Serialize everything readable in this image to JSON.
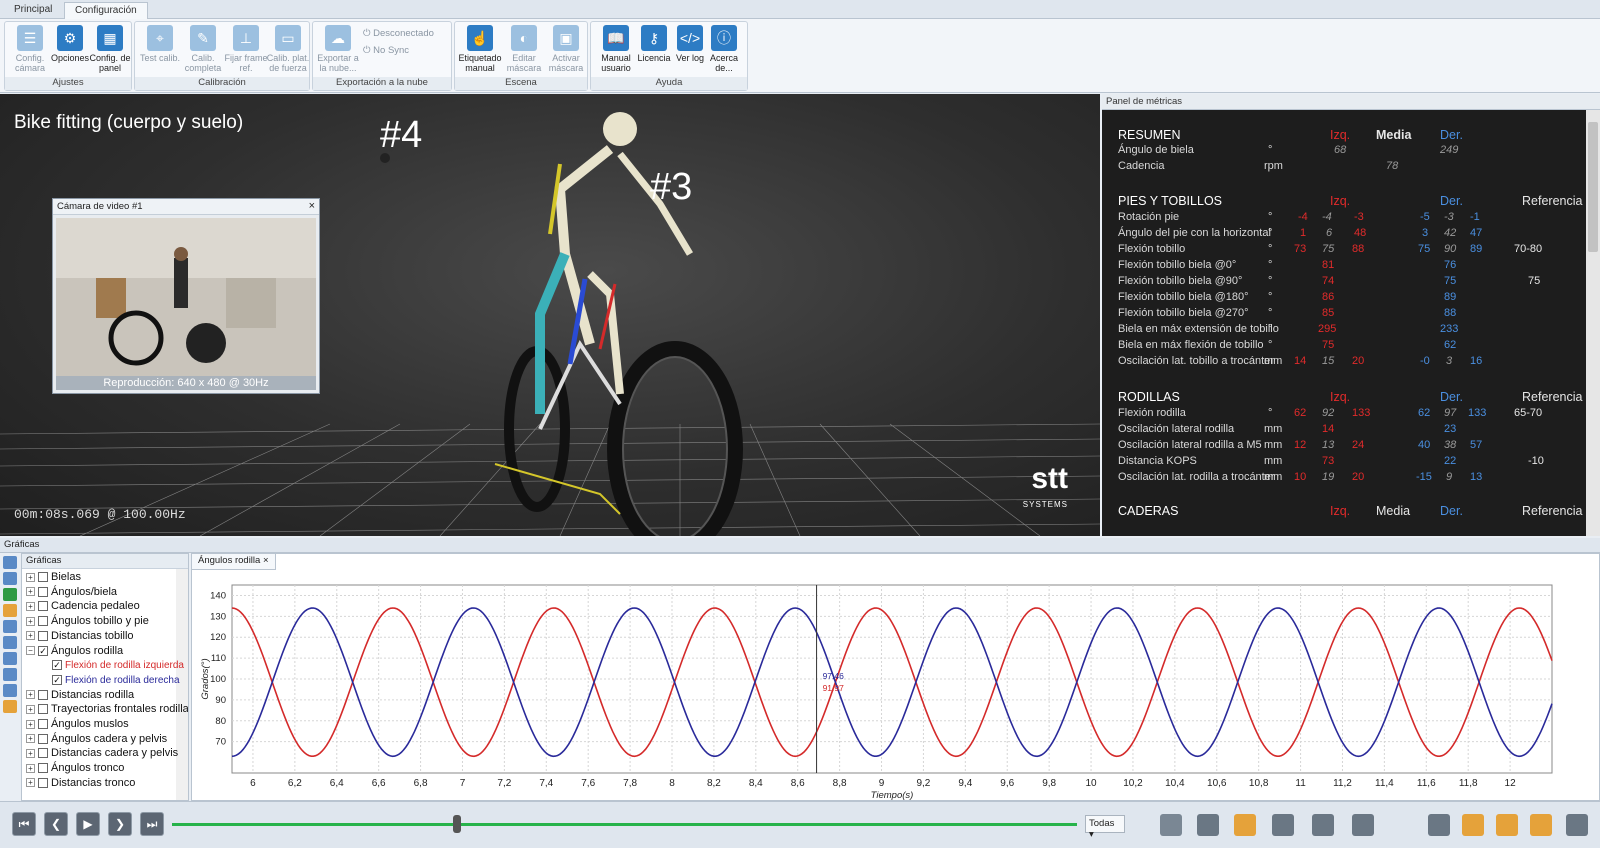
{
  "tabs": [
    {
      "label": "Principal"
    },
    {
      "label": "Configuración"
    }
  ],
  "ribbon": {
    "groups": {
      "ajustes": "Ajustes",
      "calibracion": "Calibración",
      "exportacion": "Exportación a la nube",
      "escena": "Escena",
      "ayuda": "Ayuda"
    },
    "buttons": {
      "config_camara": "Config. cámara",
      "opciones": "Opciones",
      "config_panel": "Config. de panel",
      "test_calib": "Test calib.",
      "calib_completa": "Calib. completa",
      "fijar_frame": "Fijar frame ref.",
      "calib_plat": "Calib. plat. de fuerza",
      "exportar": "Exportar a la nube...",
      "desconectado": "Desconectado",
      "no_sync": "No Sync",
      "etiquetado": "Etiquetado manual",
      "editar_mascara": "Editar máscara",
      "activar_mascara": "Activar máscara",
      "manual_usuario": "Manual usuario",
      "licencia": "Licencia",
      "ver_log": "Ver log",
      "acerca": "Acerca de..."
    }
  },
  "view3d": {
    "title": "Bike fitting (cuerpo y suelo)",
    "marker4": "#4",
    "marker3": "#3",
    "timestamp": "00m:08s.069 @ 100.00Hz",
    "logo": "stt",
    "logo_sub": "SYSTEMS"
  },
  "video": {
    "title": "Cámara de video #1",
    "close": "×",
    "caption": "Reproducción: 640 x 480 @ 30Hz"
  },
  "metrics": {
    "panel_title": "Panel de métricas",
    "col_izq": "Izq.",
    "col_media": "Media",
    "col_der": "Der.",
    "col_ref": "Referencia",
    "sections": {
      "resumen": "RESUMEN",
      "pies": "PIES Y TOBILLOS",
      "rodillas": "RODILLAS",
      "caderas": "CADERAS"
    },
    "rows": {
      "angulo_biela": {
        "label": "Ángulo de biela",
        "unit": "°",
        "izq": "68",
        "der": "249"
      },
      "cadencia": {
        "label": "Cadencia",
        "unit": "rpm",
        "media": "78"
      },
      "rotacion_pie": {
        "label": "Rotación pie",
        "unit": "°",
        "i1": "-4",
        "i2": "-4",
        "i3": "-3",
        "d1": "-5",
        "d2": "-3",
        "d3": "-1"
      },
      "angulo_pie": {
        "label": "Ángulo del pie con la horizontal",
        "unit": "°",
        "i1": "1",
        "i2": "6",
        "i3": "48",
        "d1": "3",
        "d2": "42",
        "d3": "47"
      },
      "flexion_tobillo": {
        "label": "Flexión tobillo",
        "unit": "°",
        "i1": "73",
        "i2": "75",
        "i3": "88",
        "d1": "75",
        "d2": "90",
        "d3": "89",
        "ref": "70-80"
      },
      "flex_0": {
        "label": "Flexión tobillo biela @0°",
        "unit": "°",
        "i": "81",
        "d": "76"
      },
      "flex_90": {
        "label": "Flexión tobillo biela @90°",
        "unit": "°",
        "i": "74",
        "d": "75",
        "ref": "75"
      },
      "flex_180": {
        "label": "Flexión tobillo biela @180°",
        "unit": "°",
        "i": "86",
        "d": "89"
      },
      "flex_270": {
        "label": "Flexión tobillo biela @270°",
        "unit": "°",
        "i": "85",
        "d": "88"
      },
      "biela_max_ext": {
        "label": "Biela en máx extensión de tobillo",
        "unit": "°",
        "i": "295",
        "d": "233"
      },
      "biela_max_flex": {
        "label": "Biela en máx flexión de tobillo",
        "unit": "°",
        "i": "75",
        "d": "62"
      },
      "osc_tobillo": {
        "label": "Oscilación lat. tobillo a trocánter",
        "unit": "mm",
        "i1": "14",
        "i2": "15",
        "i3": "20",
        "d1": "-0",
        "d2": "3",
        "d3": "16"
      },
      "flexion_rodilla": {
        "label": "Flexión rodilla",
        "unit": "°",
        "i1": "62",
        "i2": "92",
        "i3": "133",
        "d1": "62",
        "d2": "97",
        "d3": "133",
        "ref": "65-70"
      },
      "osc_rodilla": {
        "label": "Oscilación lateral rodilla",
        "unit": "mm",
        "i": "14",
        "d": "23"
      },
      "osc_rodilla_m5": {
        "label": "Oscilación lateral rodilla a M5",
        "unit": "mm",
        "i1": "12",
        "i2": "13",
        "i3": "24",
        "d1": "40",
        "d2": "38",
        "d3": "57"
      },
      "kops": {
        "label": "Distancia KOPS",
        "unit": "mm",
        "i": "73",
        "d": "22",
        "ref": "-10"
      },
      "osc_rod_troc": {
        "label": "Oscilación lat. rodilla a trocánter",
        "unit": "mm",
        "i1": "10",
        "i2": "19",
        "i3": "20",
        "d1": "-15",
        "d2": "9",
        "d3": "13"
      }
    }
  },
  "graphs": {
    "header": "Gráficas",
    "tree_title": "Gráficas",
    "tree": [
      {
        "label": "Bielas"
      },
      {
        "label": "Ángulos/biela"
      },
      {
        "label": "Cadencia pedaleo"
      },
      {
        "label": "Ángulos tobillo y pie"
      },
      {
        "label": "Distancias tobillo"
      },
      {
        "label": "Ángulos rodilla"
      },
      {
        "label": "Flexión de rodilla izquierda"
      },
      {
        "label": "Flexión de rodilla derecha"
      },
      {
        "label": "Distancias rodilla"
      },
      {
        "label": "Trayectorias frontales rodilla"
      },
      {
        "label": "Ángulos muslos"
      },
      {
        "label": "Ángulos cadera y pelvis"
      },
      {
        "label": "Distancias cadera y pelvis"
      },
      {
        "label": "Ángulos tronco"
      },
      {
        "label": "Distancias tronco"
      }
    ],
    "chart_tab": "Ángulos rodilla",
    "chart_tab_close": "×",
    "speed": "Todas"
  },
  "chart_data": {
    "type": "line",
    "xlabel": "Tiempo(s)",
    "ylabel": "Grados(°)",
    "xlim": [
      5.9,
      12.2
    ],
    "ylim": [
      55,
      145
    ],
    "xticks": [
      "6",
      "6,2",
      "6,4",
      "6,6",
      "6,8",
      "7",
      "7,2",
      "7,4",
      "7,6",
      "7,8",
      "8",
      "8,2",
      "8,4",
      "8,6",
      "8,8",
      "9",
      "9,2",
      "9,4",
      "9,6",
      "9,8",
      "10",
      "10,2",
      "10,4",
      "10,6",
      "10,8",
      "11",
      "11,2",
      "11,4",
      "11,6",
      "11,8",
      "12"
    ],
    "yticks": [
      "70",
      "80",
      "90",
      "100",
      "110",
      "120",
      "130",
      "140"
    ],
    "cursor_x": 8.69,
    "cursor_labels": [
      "97.46",
      "91.97"
    ],
    "series": [
      {
        "name": "Flexión de rodilla izquierda",
        "color": "#d42a2a",
        "mean": 98.5,
        "amp": 35.5,
        "period": 0.768,
        "phase": 5.9
      },
      {
        "name": "Flexión de rodilla derecha",
        "color": "#2a2a9a",
        "mean": 98.5,
        "amp": 35.5,
        "period": 0.768,
        "phase": 5.9
      }
    ],
    "grid": true
  },
  "colors": {
    "accent": "#2d7cc4",
    "left": "#e12b2b",
    "right": "#4a8fe0",
    "timeline": "#27b34a"
  }
}
